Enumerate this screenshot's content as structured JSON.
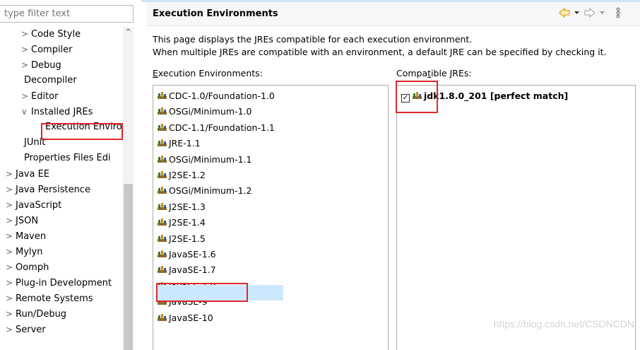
{
  "filter": {
    "placeholder": "type filter text"
  },
  "tree": [
    {
      "label": "Code Style",
      "arrow": ">"
    },
    {
      "label": "Compiler",
      "arrow": ">"
    },
    {
      "label": "Debug",
      "arrow": ">"
    },
    {
      "label": "Decompiler",
      "arrow": ""
    },
    {
      "label": "Editor",
      "arrow": ">"
    },
    {
      "label": "Installed JREs",
      "arrow": "∨"
    },
    {
      "label": "Execution Enviro",
      "arrow": ""
    },
    {
      "label": "JUnit",
      "arrow": ""
    },
    {
      "label": "Properties Files Edi",
      "arrow": ""
    },
    {
      "label": "Java EE",
      "arrow": ">"
    },
    {
      "label": "Java Persistence",
      "arrow": ">"
    },
    {
      "label": "JavaScript",
      "arrow": ">"
    },
    {
      "label": "JSON",
      "arrow": ">"
    },
    {
      "label": "Maven",
      "arrow": ">"
    },
    {
      "label": "Mylyn",
      "arrow": ">"
    },
    {
      "label": "Oomph",
      "arrow": ">"
    },
    {
      "label": "Plug-in Development",
      "arrow": ">"
    },
    {
      "label": "Remote Systems",
      "arrow": ">"
    },
    {
      "label": "Run/Debug",
      "arrow": ">"
    },
    {
      "label": "Server",
      "arrow": ">"
    }
  ],
  "page": {
    "title": "Execution Environments",
    "desc1": "This page displays the JREs compatible for each execution environment.",
    "desc2": "When multiple JREs are compatible with an environment, a default JRE can be specified by checking it.",
    "env_label_mnemonic": "E",
    "env_label_rest": "xecution Environments:",
    "jre_label_pre": "Compa",
    "jre_label_mnemonic": "t",
    "jre_label_rest": "ible JREs:"
  },
  "nav": {
    "back_icon": "back-arrow-icon",
    "forward_icon": "forward-arrow-icon",
    "menu_icon": "view-menu-icon"
  },
  "environments": [
    "CDC-1.0/Foundation-1.0",
    "OSGi/Minimum-1.0",
    "CDC-1.1/Foundation-1.1",
    "JRE-1.1",
    "OSGi/Minimum-1.1",
    "J2SE-1.2",
    "OSGi/Minimum-1.2",
    "J2SE-1.3",
    "J2SE-1.4",
    "J2SE-1.5",
    "JavaSE-1.6",
    "JavaSE-1.7",
    "JavaSE-1.8",
    "JavaSE-9",
    "JavaSE-10"
  ],
  "jres": [
    {
      "label": "jdk1.8.0_201 [perfect match]",
      "checked": true
    }
  ],
  "watermark": "https://blog.csdn.net/CSDNCDN",
  "colors": {
    "highlight": "#cce8ff",
    "annotation": "#e0262a",
    "nav_arrow": "#e6a817"
  }
}
